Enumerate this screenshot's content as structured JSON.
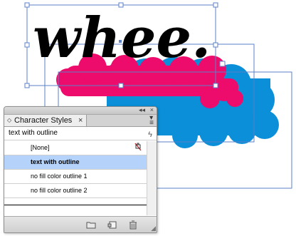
{
  "artwork": {
    "main_text": "whee.",
    "fill_color": "#000000",
    "pink_color": "#ed0b6b",
    "blue_color": "#0a8fd8",
    "frame_color": "#5b82c9"
  },
  "panel": {
    "title": "Character Styles",
    "close_glyph": "×",
    "collapse_glyph": "◇",
    "current_style": "text with outline",
    "styles": [
      {
        "label": "[None]",
        "selected": false
      },
      {
        "label": "text with outline",
        "selected": true
      },
      {
        "label": "no fill color outline 1",
        "selected": false
      },
      {
        "label": "no fill color outline 2",
        "selected": false
      }
    ],
    "selection_color": "#b5d2fb"
  },
  "icons": {
    "lock": "lock-icon",
    "menu": "panel-menu-icon",
    "lightning": "quick-apply-icon",
    "new_group": "folder-icon",
    "new_style": "new-style-icon",
    "delete": "trash-icon"
  }
}
